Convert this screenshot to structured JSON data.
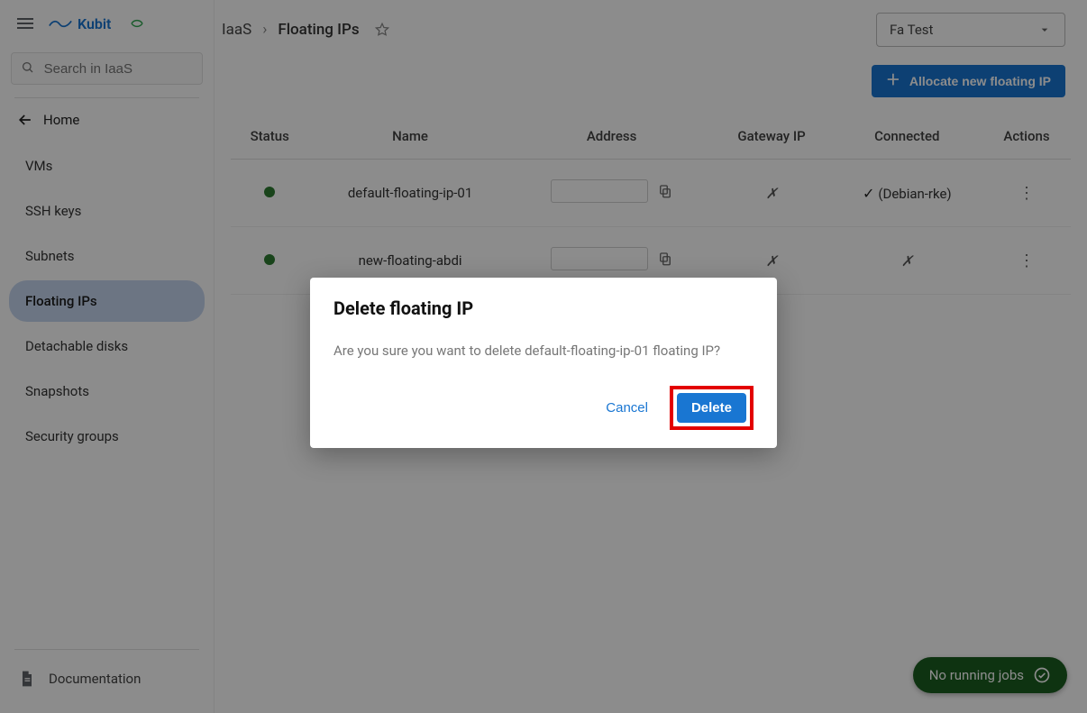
{
  "logo": {
    "text": "Kubit"
  },
  "sidebar": {
    "search_placeholder": "Search in IaaS",
    "home_label": "Home",
    "items": [
      {
        "label": "VMs"
      },
      {
        "label": "SSH keys"
      },
      {
        "label": "Subnets"
      },
      {
        "label": "Floating IPs"
      },
      {
        "label": "Detachable disks"
      },
      {
        "label": "Snapshots"
      },
      {
        "label": "Security groups"
      }
    ],
    "active_index": 3,
    "documentation_label": "Documentation"
  },
  "breadcrumb": {
    "root": "IaaS",
    "current": "Floating IPs"
  },
  "project_selector": {
    "value": "Fa Test"
  },
  "actions": {
    "allocate_label": "Allocate new floating IP"
  },
  "table": {
    "columns": [
      "Status",
      "Name",
      "Address",
      "Gateway IP",
      "Connected",
      "Actions"
    ],
    "rows": [
      {
        "status": "active",
        "name": "default-floating-ip-01",
        "address": "",
        "gateway": "✗",
        "connected_check": true,
        "connected_label": "(Debian-rke)"
      },
      {
        "status": "active",
        "name": "new-floating-abdi",
        "address": "",
        "gateway": "✗",
        "connected_check": false,
        "connected_label": "✗"
      }
    ]
  },
  "modal": {
    "title": "Delete floating IP",
    "message": "Are you sure you want to delete default-floating-ip-01 floating IP?",
    "cancel_label": "Cancel",
    "confirm_label": "Delete"
  },
  "jobs": {
    "label": "No running jobs"
  }
}
